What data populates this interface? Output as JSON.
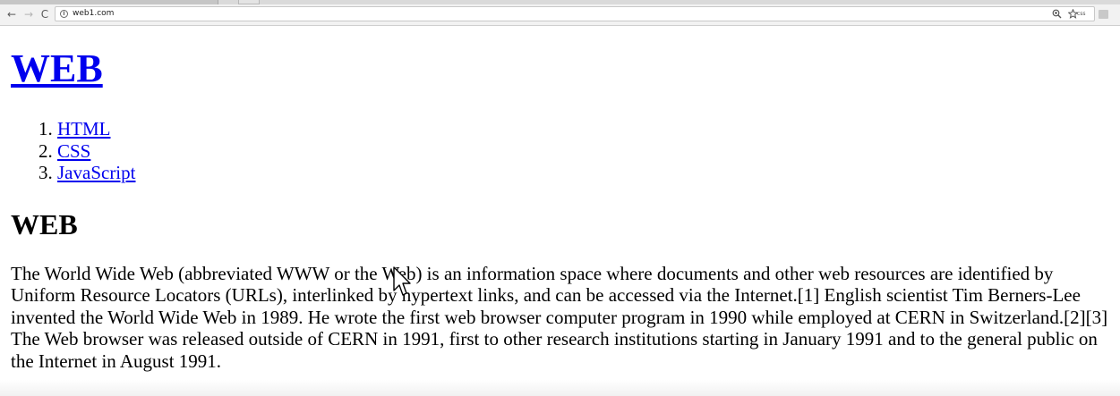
{
  "browser": {
    "url": "web1.com",
    "info_glyph": "i",
    "back_glyph": "←",
    "forward_glyph": "→",
    "reload_glyph": "C",
    "extension_label": "css"
  },
  "page": {
    "site_title": "WEB",
    "nav": [
      {
        "label": "HTML"
      },
      {
        "label": "CSS"
      },
      {
        "label": "JavaScript"
      }
    ],
    "article_title": "WEB",
    "article_body": "The World Wide Web (abbreviated WWW or the Web) is an information space where documents and other web resources are identified by Uniform Resource Locators (URLs), interlinked by hypertext links, and can be accessed via the Internet.[1] English scientist Tim Berners-Lee invented the World Wide Web in 1989. He wrote the first web browser computer program in 1990 while employed at CERN in Switzerland.[2][3] The Web browser was released outside of CERN in 1991, first to other research institutions starting in January 1991 and to the general public on the Internet in August 1991."
  },
  "colors": {
    "link": "#0000ee",
    "text": "#000000",
    "toolbar": "#f2f2f2"
  }
}
